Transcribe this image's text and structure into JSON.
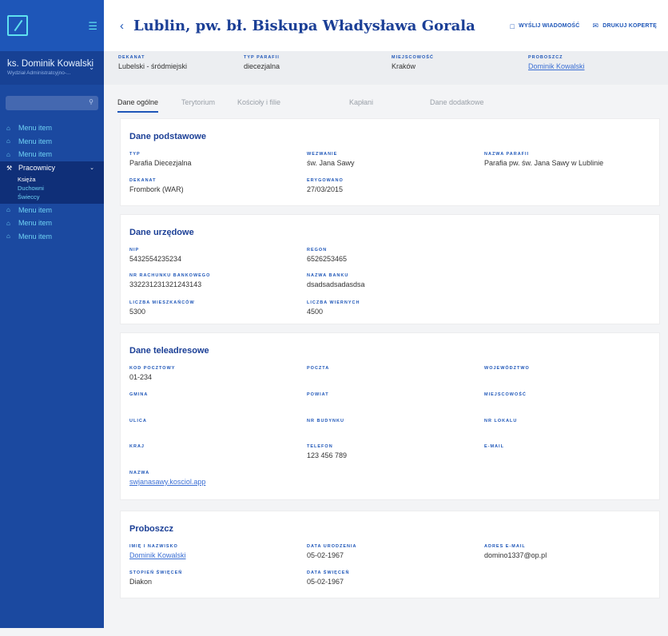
{
  "sidebar": {
    "user": {
      "name": "ks. Dominik Kowalski",
      "subtitle": "Wydział Administratcyjno-..."
    },
    "search": {
      "placeholder": "",
      "value": ""
    },
    "items_top": [
      {
        "label": "Menu item",
        "icon": "home-icon"
      },
      {
        "label": "Menu item",
        "icon": "home-icon"
      },
      {
        "label": "Menu item",
        "icon": "home-icon"
      }
    ],
    "group": {
      "label": "Pracownicy",
      "icon": "wrench-icon",
      "children": [
        {
          "label": "Księża",
          "active": true
        },
        {
          "label": "Duchowni",
          "active": false
        },
        {
          "label": "Świeccy",
          "active": false
        }
      ]
    },
    "items_bottom": [
      {
        "label": "Menu item",
        "icon": "home-icon"
      },
      {
        "label": "Menu item",
        "icon": "home-icon"
      },
      {
        "label": "Menu item",
        "icon": "home-icon"
      }
    ]
  },
  "header": {
    "title": "Lublin, pw. bł. Biskupa Władysława Gorala",
    "send_message": "WYŚLIJ WIADOMOŚĆ",
    "print_envelope": "DRUKUJ KOPERTĘ"
  },
  "meta": {
    "dekanat": {
      "label": "DEKANAT",
      "value": "Lubelski - śródmiejski"
    },
    "typ": {
      "label": "TYP PARAFII",
      "value": "diecezjalna"
    },
    "miejscowosc": {
      "label": "MIEJSCOWOŚĆ",
      "value": "Kraków"
    },
    "proboszcz": {
      "label": "PROBOSZCZ",
      "value": "Dominik Kowalski"
    }
  },
  "tabs": [
    "Dane ogólne",
    "Terytorium",
    "Kościoły i filie",
    "Kapłani",
    "Dane dodatkowe"
  ],
  "podstawowe": {
    "title": "Dane podstawowe",
    "typ": {
      "label": "TYP",
      "value": "Parafia Diecezjalna"
    },
    "wezwanie": {
      "label": "WEZWANIE",
      "value": "św. Jana Sawy"
    },
    "nazwa": {
      "label": "NAZWA PARAFII",
      "value": "Parafia pw. św. Jana Sawy w Lublinie"
    },
    "dekanat": {
      "label": "DEKANAT",
      "value": "Frombork (WAR)"
    },
    "erygowano": {
      "label": "ERYGOWANO",
      "value": "27/03/2015"
    }
  },
  "urzedowe": {
    "title": "Dane urzędowe",
    "nip": {
      "label": "NIP",
      "value": "5432554235234"
    },
    "regon": {
      "label": "REGON",
      "value": "6526253465"
    },
    "rachunek": {
      "label": "NR RACHUNKU BANKOWEGO",
      "value": "332231231321243143"
    },
    "bank": {
      "label": "NAZWA BANKU",
      "value": "dsadsadsadasdsa"
    },
    "mieszkancy": {
      "label": "LICZBA MIESZKAŃCÓW",
      "value": "5300"
    },
    "wierni": {
      "label": "LICZBA WIERNYCH",
      "value": "4500"
    }
  },
  "teleadresowe": {
    "title": "Dane teleadresowe",
    "kod": {
      "label": "KOD POCZTOWY",
      "value": "01-234"
    },
    "poczta": {
      "label": "POCZTA",
      "value": ""
    },
    "wojewodztwo": {
      "label": "WOJEWÓDZTWO",
      "value": ""
    },
    "gmina": {
      "label": "GMINA",
      "value": ""
    },
    "powiat": {
      "label": "POWIAT",
      "value": ""
    },
    "miejscowosc": {
      "label": "MIEJSCOWOŚĆ",
      "value": ""
    },
    "ulica": {
      "label": "ULICA",
      "value": ""
    },
    "budynek": {
      "label": "NR BUDYNKU",
      "value": ""
    },
    "lokal": {
      "label": "NR LOKALU",
      "value": ""
    },
    "kraj": {
      "label": "KRAJ",
      "value": ""
    },
    "telefon": {
      "label": "TELEFON",
      "value": "123 456 789"
    },
    "email": {
      "label": "E-MAIL",
      "value": ""
    },
    "nazwa": {
      "label": "NAZWA",
      "value": "swjanasawy.kosciol.app"
    }
  },
  "proboszcz": {
    "title": "Proboszcz",
    "imie": {
      "label": "IMIĘ I NAZWISKO",
      "value": "Dominik Kowalski"
    },
    "urodzenie": {
      "label": "DATA URODZENIA",
      "value": "05-02-1967"
    },
    "email": {
      "label": "ADRES E-MAIL",
      "value": "domino1337@op.pl"
    },
    "stopien": {
      "label": "STOPIEŃ ŚWIĘCEŃ",
      "value": "Diakon"
    },
    "swiecenia": {
      "label": "DATA ŚWIĘCEŃ",
      "value": "05-02-1967"
    }
  }
}
